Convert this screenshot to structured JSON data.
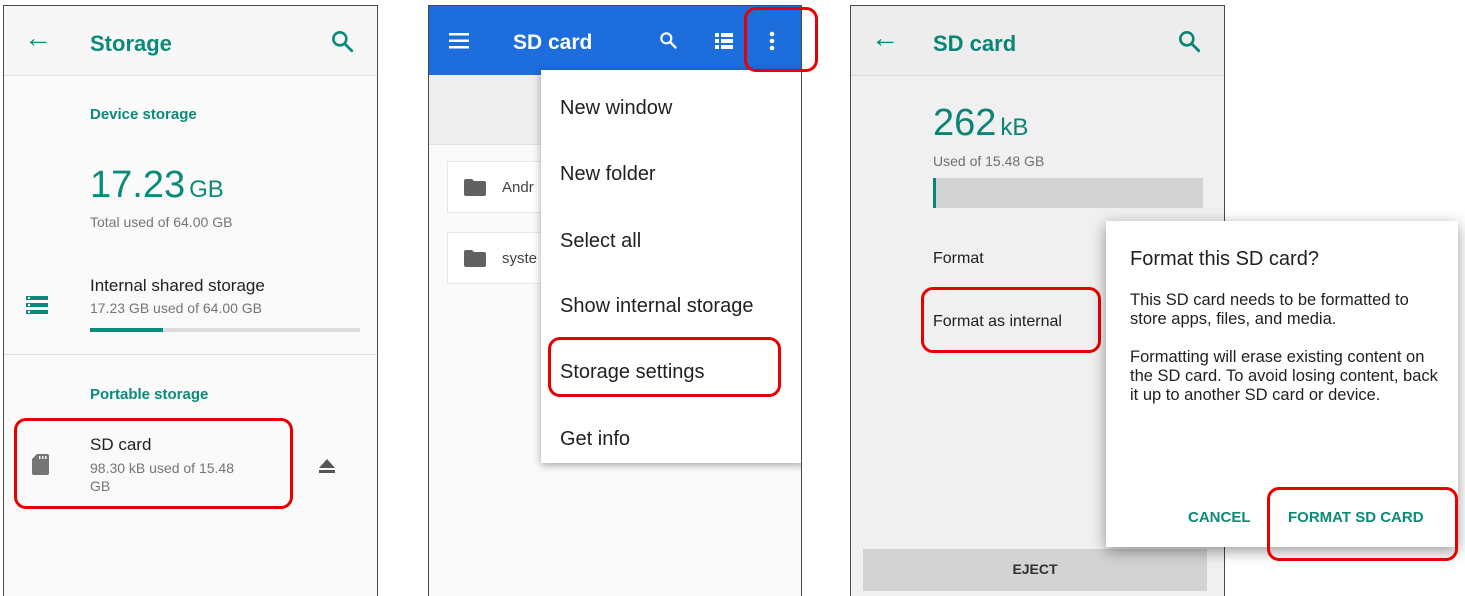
{
  "colors": {
    "accent": "#0b8a7a",
    "app_bar_blue": "#1d6ddd",
    "highlight": "#e80000"
  },
  "storage_screen": {
    "title": "Storage",
    "device_storage_heading": "Device storage",
    "total_used_value": "17.23",
    "total_used_unit": "GB",
    "total_used_caption": "Total used of 64.00 GB",
    "internal": {
      "title": "Internal shared storage",
      "subtitle": "17.23 GB used of 64.00 GB",
      "usage_fraction": 0.27
    },
    "portable_heading": "Portable storage",
    "sd": {
      "title": "SD card",
      "subtitle_line1": "98.30 kB used of 15.48",
      "subtitle_line2": "GB"
    }
  },
  "files_screen": {
    "title": "SD card",
    "folders": [
      {
        "label": "Andr"
      },
      {
        "label": "syste"
      }
    ],
    "menu": [
      "New window",
      "New folder",
      "Select all",
      "Show internal storage",
      "Storage settings",
      "Get info"
    ]
  },
  "sd_screen": {
    "title": "SD card",
    "used_value": "262",
    "used_unit": "kB",
    "used_caption": "Used of 15.48 GB",
    "usage_fraction": 0.01,
    "format_label": "Format",
    "format_internal_label": "Format as internal",
    "eject_label": "EJECT"
  },
  "dialog": {
    "title": "Format this SD card?",
    "body_p1": "This SD card needs to be formatted to store apps, files, and media.",
    "body_p2": "Formatting will erase existing content on the SD card. To avoid losing content, back it up to another SD card or device.",
    "cancel": "CANCEL",
    "confirm": "FORMAT SD CARD"
  }
}
